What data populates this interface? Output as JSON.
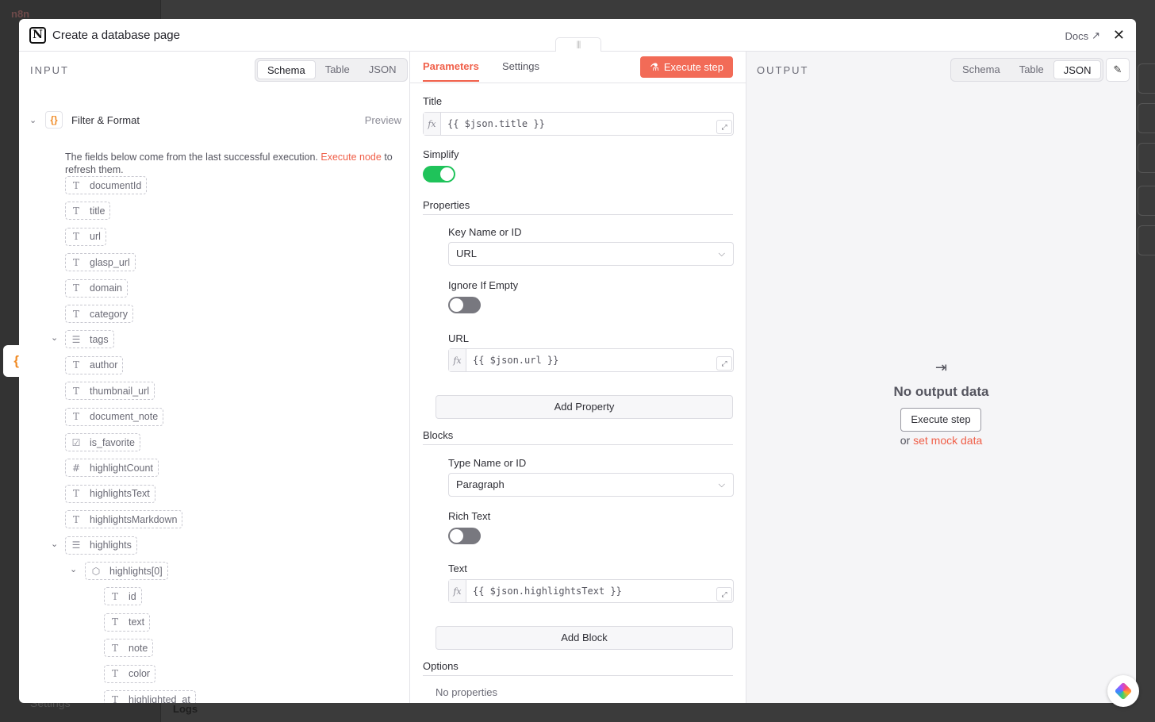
{
  "background": {
    "app_name": "n8n",
    "logs_label": "Logs",
    "settings_label": "Settings"
  },
  "modal": {
    "title": "Create a database page",
    "docs_label": "Docs"
  },
  "input": {
    "label": "INPUT",
    "view_tabs": [
      "Schema",
      "Table",
      "JSON"
    ],
    "active_tab": "Schema",
    "node_name": "Filter & Format",
    "preview_label": "Preview",
    "info_text": "The fields below come from the last successful execution.",
    "info_link": "Execute node",
    "info_suffix": "to refresh them.",
    "fields": [
      {
        "name": "documentId",
        "type": "string"
      },
      {
        "name": "title",
        "type": "string"
      },
      {
        "name": "url",
        "type": "string"
      },
      {
        "name": "glasp_url",
        "type": "string"
      },
      {
        "name": "domain",
        "type": "string"
      },
      {
        "name": "category",
        "type": "string"
      },
      {
        "name": "tags",
        "type": "array"
      },
      {
        "name": "author",
        "type": "string"
      },
      {
        "name": "thumbnail_url",
        "type": "string"
      },
      {
        "name": "document_note",
        "type": "string"
      },
      {
        "name": "is_favorite",
        "type": "boolean"
      },
      {
        "name": "highlightCount",
        "type": "number"
      },
      {
        "name": "highlightsText",
        "type": "string"
      },
      {
        "name": "highlightsMarkdown",
        "type": "string"
      },
      {
        "name": "highlights",
        "type": "array"
      },
      {
        "name": "highlights[0]",
        "type": "object"
      },
      {
        "name": "id",
        "type": "string"
      },
      {
        "name": "text",
        "type": "string"
      },
      {
        "name": "note",
        "type": "string"
      },
      {
        "name": "color",
        "type": "string"
      },
      {
        "name": "highlighted_at",
        "type": "string"
      }
    ],
    "type_icons": {
      "string": "T",
      "array": "☰",
      "boolean": "☑",
      "number": "#",
      "object": "⬡"
    }
  },
  "parameters": {
    "tab_parameters": "Parameters",
    "tab_settings": "Settings",
    "execute_label": "Execute step",
    "title_label": "Title",
    "title_value": "{{ $json.title }}",
    "simplify_label": "Simplify",
    "simplify_on": true,
    "properties_label": "Properties",
    "key_name_label": "Key Name or ID",
    "key_name_value": "URL",
    "ignore_empty_label": "Ignore If Empty",
    "ignore_empty_on": false,
    "url_label": "URL",
    "url_value": "{{ $json.url }}",
    "add_property_label": "Add Property",
    "blocks_label": "Blocks",
    "type_name_label": "Type Name or ID",
    "type_name_value": "Paragraph",
    "rich_text_label": "Rich Text",
    "rich_text_on": false,
    "text_label": "Text",
    "text_value": "{{ $json.highlightsText }}",
    "add_block_label": "Add Block",
    "options_label": "Options",
    "no_properties_label": "No properties"
  },
  "output": {
    "label": "OUTPUT",
    "view_tabs": [
      "Schema",
      "Table",
      "JSON"
    ],
    "active_tab": "JSON",
    "no_output_label": "No output data",
    "execute_label": "Execute step",
    "or_label": "or",
    "mock_link": "set mock data"
  },
  "colors": {
    "accent": "#f0604a",
    "toggle_on": "#1fc35a",
    "node_icon": "#f08a24"
  }
}
